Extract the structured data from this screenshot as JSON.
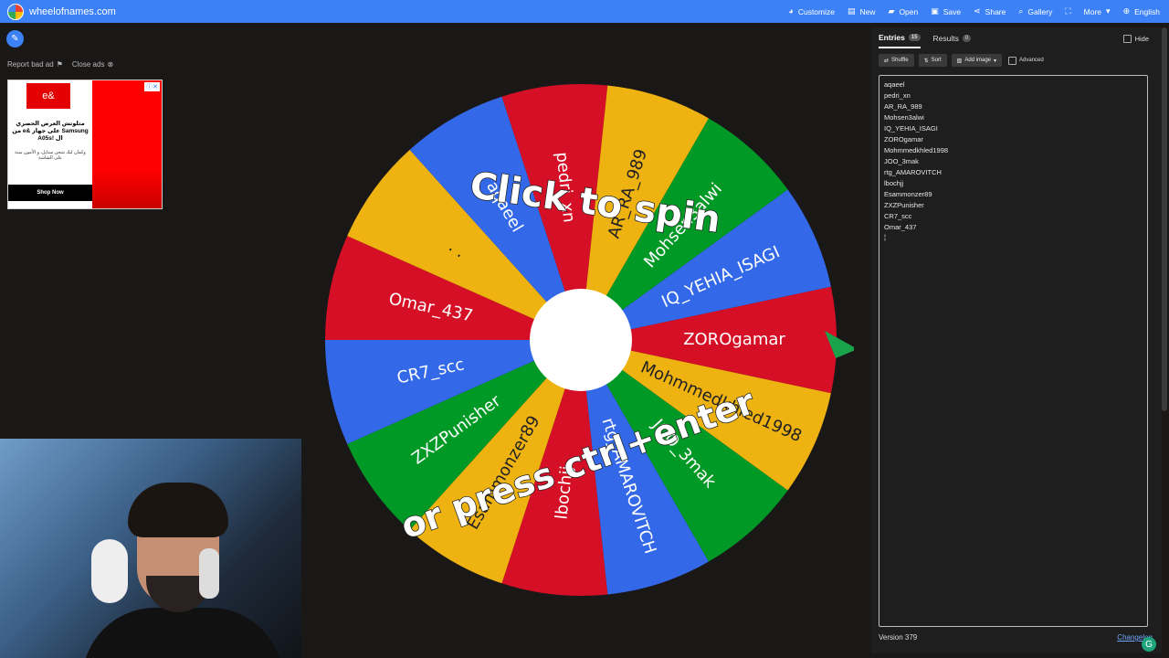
{
  "header": {
    "site": "wheelofnames.com",
    "nav": [
      {
        "label": "Customize",
        "icon": "palette-icon"
      },
      {
        "label": "New",
        "icon": "file-icon"
      },
      {
        "label": "Open",
        "icon": "folder-icon"
      },
      {
        "label": "Save",
        "icon": "save-icon"
      },
      {
        "label": "Share",
        "icon": "share-icon"
      },
      {
        "label": "Gallery",
        "icon": "search-icon"
      },
      {
        "label": "",
        "icon": "fullscreen-icon"
      },
      {
        "label": "More",
        "icon": "chevron-down-icon"
      },
      {
        "label": "English",
        "icon": "globe-icon"
      }
    ]
  },
  "ad": {
    "report_label": "Report bad ad",
    "close_label": "Close ads",
    "logo_text": "e&",
    "headline": "متلوتش العرض الحصري من e& على جهاز Samsung A05s! ال",
    "subtext": "وكمان ليك شحن ستايل، و الأمون سنة على الشاشة",
    "cta": "Shop Now"
  },
  "wheel": {
    "segments": [
      {
        "label": "IQ_YEHIA_ISAGI",
        "color": "#3369e8"
      },
      {
        "label": "ZOROgamar",
        "color": "#d50f25"
      },
      {
        "label": "Mohmmedkhled1998",
        "color": "#eeb211"
      },
      {
        "label": "JOO_3mak",
        "color": "#009925"
      },
      {
        "label": "rtg_AMAROVITCH",
        "color": "#3369e8"
      },
      {
        "label": "lbochjj",
        "color": "#d50f25"
      },
      {
        "label": "Esammonzer89",
        "color": "#eeb211"
      },
      {
        "label": "ZXZPunisher",
        "color": "#009925"
      },
      {
        "label": "CR7_scc",
        "color": "#3369e8"
      },
      {
        "label": "Omar_437",
        "color": "#d50f25"
      },
      {
        "label": ". .",
        "color": "#eeb211"
      },
      {
        "label": "aqaeel",
        "color": "#3369e8"
      },
      {
        "label": "pedri_xn",
        "color": "#d50f25"
      },
      {
        "label": "AR_RA_989",
        "color": "#eeb211"
      },
      {
        "label": "Mohsen3alwi",
        "color": "#009925"
      }
    ],
    "overlay_top": "Click to spin",
    "overlay_bottom": "or press ctrl+enter",
    "pointer_color": "#1aa34a"
  },
  "panel": {
    "tab_entries": "Entries",
    "entries_count": "15",
    "tab_results": "Results",
    "results_count": "0",
    "hide_label": "Hide",
    "shuffle_label": "Shuffle",
    "sort_label": "Sort",
    "add_image_label": "Add image",
    "advanced_label": "Advanced",
    "entries": [
      "aqaeel",
      "pedri_xn",
      "AR_RA_989",
      "Mohsen3alwi",
      "IQ_YEHIA_ISAGI",
      "ZOROgamar",
      "Mohmmedkhled1998",
      "JOO_3mak",
      "rtg_AMAROVITCH",
      "lbochjj",
      "Esammonzer89",
      "ZXZPunisher",
      "CR7_scc",
      "Omar_437"
    ],
    "cursor_line": "¦",
    "version": "Version 379",
    "changelog": "Changelog"
  }
}
